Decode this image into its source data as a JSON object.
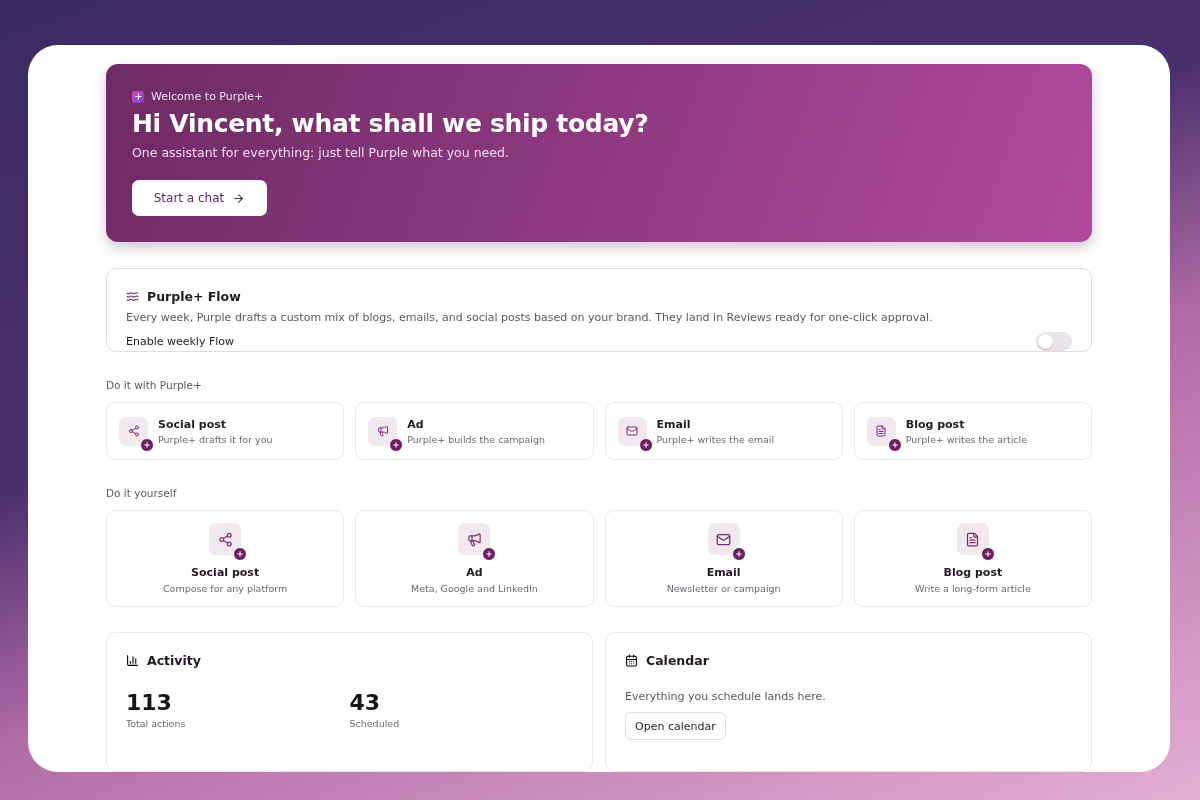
{
  "hero": {
    "eyebrow": "Welcome to Purple+",
    "title": "Hi Vincent, what shall we ship today?",
    "subtitle": "One assistant for everything: just tell Purple what you need.",
    "button": "Start a chat"
  },
  "flow": {
    "title": "Purple+ Flow",
    "description": "Every week, Purple drafts a custom mix of blogs, emails, and social posts based on your brand. They land in Reviews ready for one-click approval.",
    "toggle_label": "Enable weekly Flow",
    "on": false
  },
  "with_purple": {
    "heading": "Do it with Purple+",
    "items": [
      {
        "kind": "social",
        "title": "Social post",
        "subtitle": "Purple+ drafts it for you"
      },
      {
        "kind": "ad",
        "title": "Ad",
        "subtitle": "Purple+ builds the campaign"
      },
      {
        "kind": "email",
        "title": "Email",
        "subtitle": "Purple+ writes the email"
      },
      {
        "kind": "blog",
        "title": "Blog post",
        "subtitle": "Purple+ writes the article"
      }
    ]
  },
  "yourself": {
    "heading": "Do it yourself",
    "items": [
      {
        "kind": "social",
        "title": "Social post",
        "subtitle": "Compose for any platform"
      },
      {
        "kind": "ad",
        "title": "Ad",
        "subtitle": "Meta, Google and LinkedIn"
      },
      {
        "kind": "email",
        "title": "Email",
        "subtitle": "Newsletter or campaign"
      },
      {
        "kind": "blog",
        "title": "Blog post",
        "subtitle": "Write a long-form article"
      }
    ]
  },
  "activity": {
    "title": "Activity",
    "stats": [
      {
        "value": "113",
        "label": "Total actions"
      },
      {
        "value": "43",
        "label": "Scheduled"
      }
    ]
  },
  "calendar": {
    "title": "Calendar",
    "text": "Everything you schedule lands here.",
    "button": "Open calendar"
  }
}
